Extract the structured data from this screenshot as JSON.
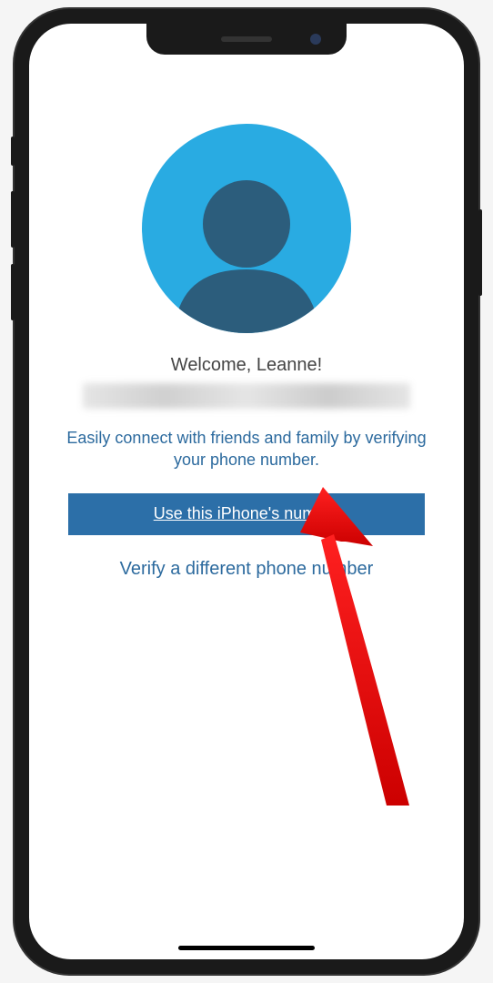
{
  "welcome": {
    "greeting": "Welcome, Leanne!",
    "description": "Easily connect with friends and family by verifying your phone number."
  },
  "buttons": {
    "primary": "Use this iPhone's number",
    "secondary": "Verify a different phone number"
  }
}
